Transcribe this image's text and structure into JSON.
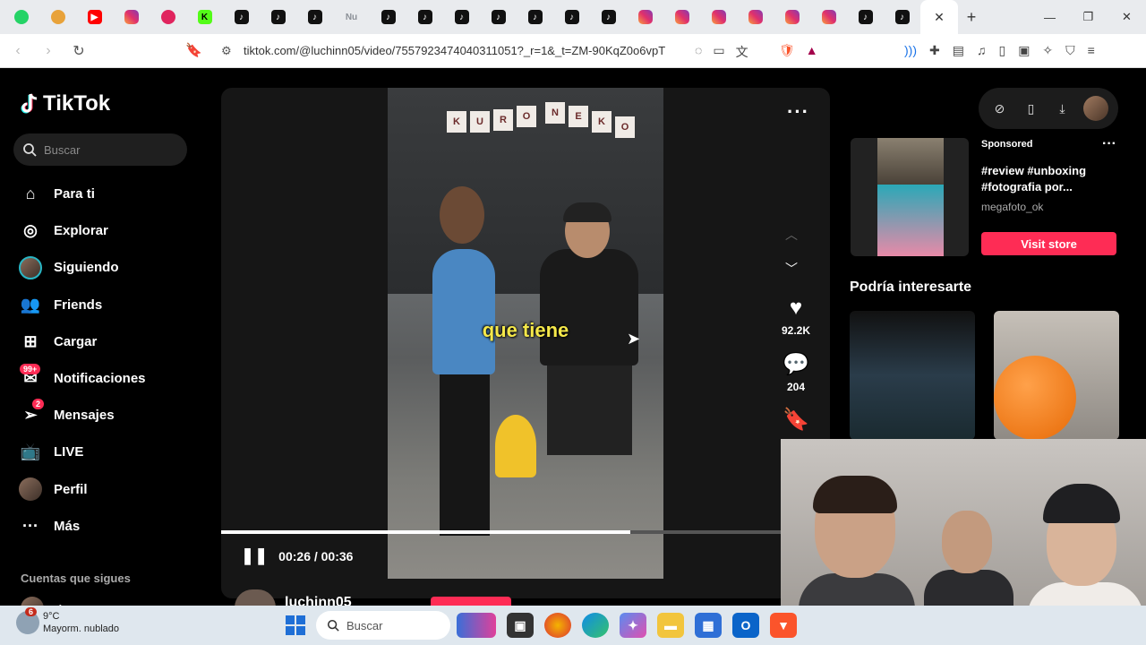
{
  "browser": {
    "tabs": [
      {
        "icon": "whatsapp-icon",
        "cls": "fav-wa",
        "glyph": ""
      },
      {
        "icon": "emoji-tab-icon",
        "cls": "fav-orange",
        "glyph": ""
      },
      {
        "icon": "youtube-icon",
        "cls": "fav-yt",
        "glyph": "▶"
      },
      {
        "icon": "instagram-icon",
        "cls": "fav-ig",
        "glyph": ""
      },
      {
        "icon": "record-icon",
        "cls": "fav-red",
        "glyph": ""
      },
      {
        "icon": "kick-icon",
        "cls": "fav-k",
        "glyph": "K"
      },
      {
        "icon": "tiktok-icon",
        "cls": "fav-tt",
        "glyph": "♪"
      },
      {
        "icon": "tiktok-icon",
        "cls": "fav-tt",
        "glyph": "♪"
      },
      {
        "icon": "tiktok-icon",
        "cls": "fav-tt",
        "glyph": "♪"
      },
      {
        "icon": "new-tab-text",
        "cls": "fav-text",
        "glyph": "Nu"
      },
      {
        "icon": "tiktok-icon",
        "cls": "fav-tt",
        "glyph": "♪"
      },
      {
        "icon": "tiktok-icon",
        "cls": "fav-tt",
        "glyph": "♪"
      },
      {
        "icon": "tiktok-icon",
        "cls": "fav-tt",
        "glyph": "♪"
      },
      {
        "icon": "tiktok-icon",
        "cls": "fav-tt",
        "glyph": "♪"
      },
      {
        "icon": "tiktok-icon",
        "cls": "fav-tt",
        "glyph": "♪"
      },
      {
        "icon": "tiktok-icon",
        "cls": "fav-tt",
        "glyph": "♪"
      },
      {
        "icon": "tiktok-icon",
        "cls": "fav-tt",
        "glyph": "♪"
      },
      {
        "icon": "instagram-icon",
        "cls": "fav-ig",
        "glyph": ""
      },
      {
        "icon": "instagram-icon",
        "cls": "fav-ig",
        "glyph": ""
      },
      {
        "icon": "instagram-icon",
        "cls": "fav-ig",
        "glyph": ""
      },
      {
        "icon": "instagram-icon",
        "cls": "fav-ig",
        "glyph": ""
      },
      {
        "icon": "instagram-icon",
        "cls": "fav-ig",
        "glyph": ""
      },
      {
        "icon": "instagram-icon",
        "cls": "fav-ig",
        "glyph": ""
      },
      {
        "icon": "tiktok-icon",
        "cls": "fav-tt",
        "glyph": "♪"
      },
      {
        "icon": "tiktok-icon",
        "cls": "fav-tt",
        "glyph": "♪"
      }
    ],
    "active_tab_close": "✕",
    "new_tab": "+",
    "url": "tiktok.com/@luchinn05/video/7557923474040311051?_r=1&_t=ZM-90KqZ0o6vpT"
  },
  "tiktok": {
    "logo_text": "TikTok",
    "search_placeholder": "Buscar",
    "nav": [
      {
        "label": "Para ti",
        "icon": "home-icon",
        "glyph": "⌂"
      },
      {
        "label": "Explorar",
        "icon": "compass-icon",
        "glyph": "◎"
      },
      {
        "label": "Siguiendo",
        "icon": "avatar-icon",
        "glyph": ""
      },
      {
        "label": "Friends",
        "icon": "friends-icon",
        "glyph": "👥"
      },
      {
        "label": "Cargar",
        "icon": "upload-icon",
        "glyph": "⊞"
      },
      {
        "label": "Notificaciones",
        "icon": "inbox-icon",
        "glyph": "✉",
        "badge": "99+"
      },
      {
        "label": "Mensajes",
        "icon": "send-icon",
        "glyph": "➢",
        "badge": "2"
      },
      {
        "label": "LIVE",
        "icon": "live-icon",
        "glyph": "📺"
      },
      {
        "label": "Perfil",
        "icon": "profile-icon",
        "glyph": ""
      },
      {
        "label": "Más",
        "icon": "more-icon",
        "glyph": "···"
      }
    ],
    "following_title": "Cuentas que sigues",
    "following_user": "Agus",
    "video": {
      "subtitle": "que tiene",
      "progress": 0.73,
      "time": "00:26 / 00:36",
      "likes": "92.2K",
      "comments": "204",
      "author": "luchinn05"
    },
    "ad": {
      "sponsored": "Sponsored",
      "title": "#review #unboxing #fotografia por...",
      "user": "megafoto_ok",
      "cta": "Visit store"
    },
    "recommend_title": "Podría interesarte"
  },
  "taskbar": {
    "weather_temp": "9°C",
    "weather_desc": "Mayorm. nublado",
    "weather_badge": "6",
    "search": "Buscar"
  }
}
